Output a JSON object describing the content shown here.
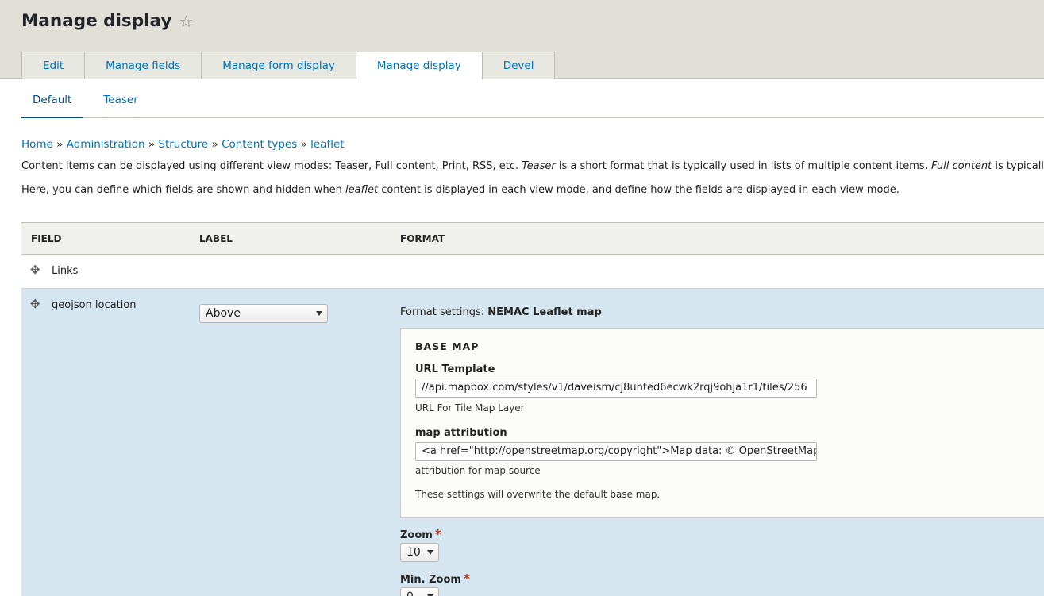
{
  "header": {
    "title": "Manage display"
  },
  "tabs": [
    {
      "label": "Edit"
    },
    {
      "label": "Manage fields"
    },
    {
      "label": "Manage form display"
    },
    {
      "label": "Manage display"
    },
    {
      "label": "Devel"
    }
  ],
  "subtabs": [
    {
      "label": "Default"
    },
    {
      "label": "Teaser"
    }
  ],
  "breadcrumb": [
    "Home",
    "Administration",
    "Structure",
    "Content types",
    "leaflet"
  ],
  "help": {
    "p1_a": "Content items can be displayed using different view modes: Teaser, Full content, Print, RSS, etc. ",
    "p1_em1": "Teaser",
    "p1_b": " is a short format that is typically used in lists of multiple content items. ",
    "p1_em2": "Full content",
    "p1_c": " is typically used",
    "p2_a": "Here, you can define which fields are shown and hidden when ",
    "p2_em": "leaflet",
    "p2_b": " content is displayed in each view mode, and define how the fields are displayed in each view mode."
  },
  "table": {
    "headers": {
      "field": "FIELD",
      "label": "LABEL",
      "format": "FORMAT"
    },
    "rows": [
      {
        "field": "Links"
      },
      {
        "field": "geojson location",
        "label_select": "Above"
      }
    ]
  },
  "format_settings": {
    "prefix": "Format settings: ",
    "formatter": "NEMAC Leaflet map",
    "base_map": {
      "legend": "BASE MAP",
      "url_label": "URL Template",
      "url_value": "//api.mapbox.com/styles/v1/daveism/cj8uhted6ecwk2rqj9ohja1r1/tiles/256",
      "url_desc": "URL For Tile Map Layer",
      "attr_label": "map attribution",
      "attr_value": "<a href=\"http://openstreetmap.org/copyright\">Map data: © OpenStreetMap</a>",
      "attr_desc": "attribution for map source",
      "note": "These settings will overwrite the default base map."
    },
    "zoom_label": "Zoom",
    "zoom_value": "10",
    "min_zoom_label": "Min. Zoom",
    "min_zoom_value": "0",
    "required_marker": "*"
  },
  "colors": {
    "link": "#0074bd",
    "header_bg": "#e0e0d8",
    "row_highlight": "#d6e6f1",
    "required": "#e32700"
  },
  "icons": {
    "star": "star-outline-icon",
    "drag": "drag-handle-icon"
  }
}
